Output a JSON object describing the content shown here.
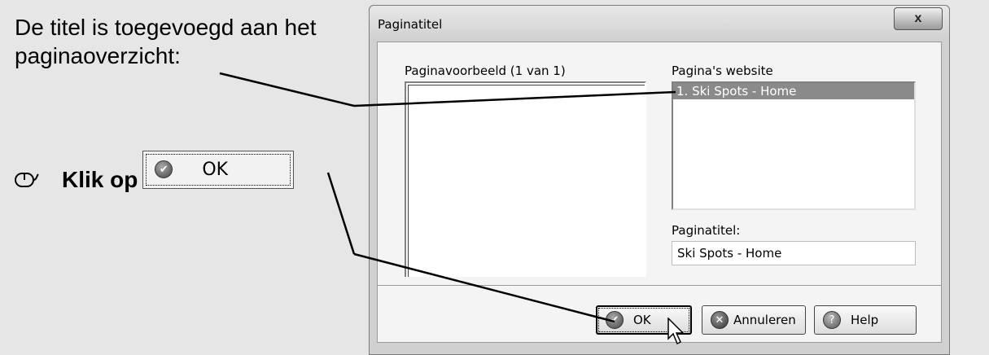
{
  "instructions": {
    "text": "De titel is toegevoegd aan het paginaoverzicht:",
    "step_label": "Klik op",
    "step_button_label": "OK"
  },
  "dialog": {
    "title": "Paginatitel",
    "close_label": "x",
    "preview_label": "Paginavoorbeeld (1 van 1)",
    "pages_label": "Pagina's website",
    "pages": [
      "1. Ski Spots - Home"
    ],
    "title_field_label": "Paginatitel:",
    "title_field_value": "Ski Spots - Home",
    "buttons": {
      "ok": "OK",
      "cancel": "Annuleren",
      "help": "Help"
    }
  }
}
